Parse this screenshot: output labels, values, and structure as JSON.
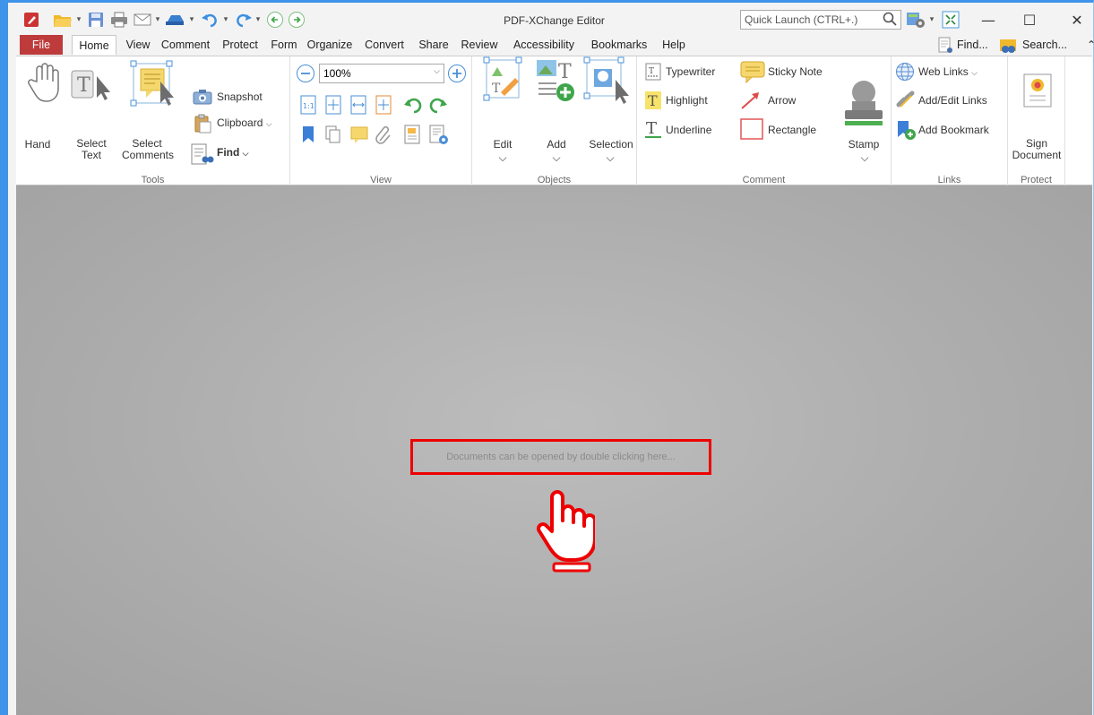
{
  "window": {
    "title": "PDF-XChange Editor",
    "quick_launch_placeholder": "Quick Launch (CTRL+.)",
    "minimize": "—",
    "maximize": "☐",
    "close": "✕"
  },
  "menu": {
    "tabs": [
      "File",
      "Home",
      "View",
      "Comment",
      "Protect",
      "Form",
      "Organize",
      "Convert",
      "Share",
      "Review",
      "Accessibility",
      "Bookmarks",
      "Help"
    ],
    "find": "Find...",
    "search": "Search..."
  },
  "ribbon": {
    "tools": {
      "hand": "Hand",
      "select_text_1": "Select",
      "select_text_2": "Text",
      "select_comments_1": "Select",
      "select_comments_2": "Comments",
      "snapshot": "Snapshot",
      "clipboard": "Clipboard",
      "find": "Find",
      "group": "Tools"
    },
    "view": {
      "zoom": "100%",
      "group": "View"
    },
    "objects": {
      "edit": "Edit",
      "add": "Add",
      "selection": "Selection",
      "group": "Objects"
    },
    "comment": {
      "typewriter": "Typewriter",
      "sticky_note": "Sticky Note",
      "highlight": "Highlight",
      "arrow": "Arrow",
      "underline": "Underline",
      "rectangle": "Rectangle",
      "stamp": "Stamp",
      "group": "Comment"
    },
    "links": {
      "web_links": "Web Links",
      "add_edit_links": "Add/Edit Links",
      "add_bookmark": "Add Bookmark",
      "group": "Links"
    },
    "protect": {
      "sign_1": "Sign",
      "sign_2": "Document",
      "group": "Protect"
    }
  },
  "workspace": {
    "hint": "Documents can be opened by double clicking here..."
  },
  "colors": {
    "accent": "#3f93e8",
    "file_tab": "#bd3b3b",
    "highlight_box": "#e00000"
  }
}
